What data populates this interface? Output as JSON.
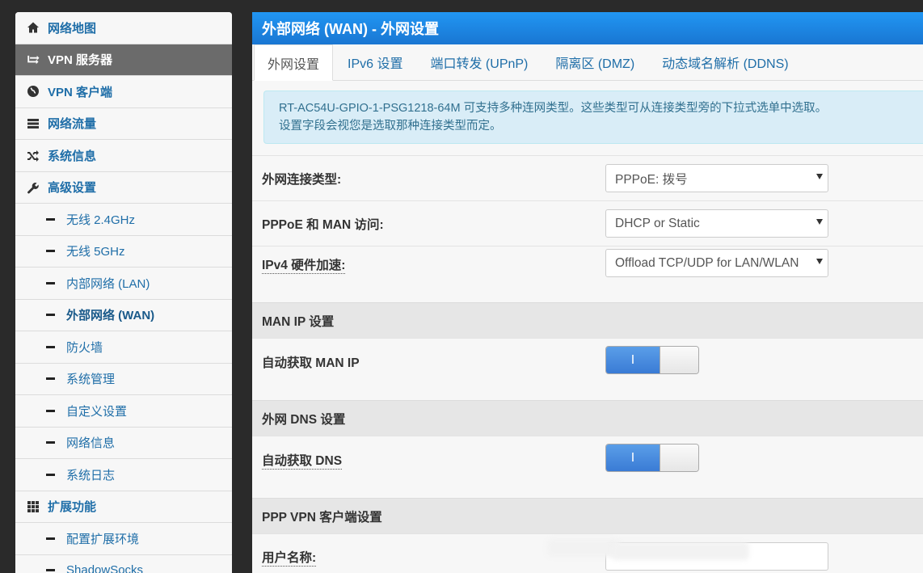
{
  "sidebar": {
    "items": [
      {
        "label": "网络地图",
        "icon": "home-icon",
        "type": "top"
      },
      {
        "label": "VPN 服务器",
        "icon": "transfer-icon",
        "type": "top",
        "active": true
      },
      {
        "label": "VPN 客户端",
        "icon": "globe-icon",
        "type": "top"
      },
      {
        "label": "网络流量",
        "icon": "server-list-icon",
        "type": "top"
      },
      {
        "label": "系统信息",
        "icon": "shuffle-icon",
        "type": "top"
      },
      {
        "label": "高级设置",
        "icon": "wrench-icon",
        "type": "top"
      },
      {
        "label": "无线 2.4GHz",
        "type": "sub"
      },
      {
        "label": "无线 5GHz",
        "type": "sub"
      },
      {
        "label": "内部网络 (LAN)",
        "type": "sub"
      },
      {
        "label": "外部网络 (WAN)",
        "type": "sub",
        "current": true
      },
      {
        "label": "防火墙",
        "type": "sub"
      },
      {
        "label": "系统管理",
        "type": "sub"
      },
      {
        "label": "自定义设置",
        "type": "sub"
      },
      {
        "label": "网络信息",
        "type": "sub"
      },
      {
        "label": "系统日志",
        "type": "sub"
      },
      {
        "label": "扩展功能",
        "icon": "grid-icon",
        "type": "top"
      },
      {
        "label": "配置扩展环境",
        "type": "sub"
      },
      {
        "label": "ShadowSocks",
        "type": "sub"
      }
    ]
  },
  "main": {
    "title": "外部网络 (WAN) - 外网设置",
    "tabs": [
      {
        "label": "外网设置",
        "active": true
      },
      {
        "label": "IPv6 设置"
      },
      {
        "label": "端口转发 (UPnP)"
      },
      {
        "label": "隔离区 (DMZ)"
      },
      {
        "label": "动态域名解析 (DDNS)"
      }
    ],
    "info_line1": "RT-AC54U-GPIO-1-PSG1218-64M 可支持多种连网类型。这些类型可从连接类型旁的下拉式选单中选取。",
    "info_line2": "设置字段会视您是选取那种连接类型而定。",
    "wan_type_label": "外网连接类型:",
    "wan_type_value": "PPPoE: 拨号",
    "man_access_label": "PPPoE 和 MAN 访问:",
    "man_access_value": "DHCP or Static",
    "hw_accel_label": "IPv4 硬件加速:",
    "hw_accel_value": "Offload TCP/UDP for LAN/WLAN",
    "man_ip_section": "MAN IP 设置",
    "auto_man_ip_label": "自动获取 MAN IP",
    "auto_man_ip_toggle": "I",
    "dns_section": "外网 DNS 设置",
    "auto_dns_label": "自动获取 DNS",
    "auto_dns_toggle": "I",
    "ppp_section": "PPP VPN 客户端设置",
    "username_label": "用户名称:"
  }
}
